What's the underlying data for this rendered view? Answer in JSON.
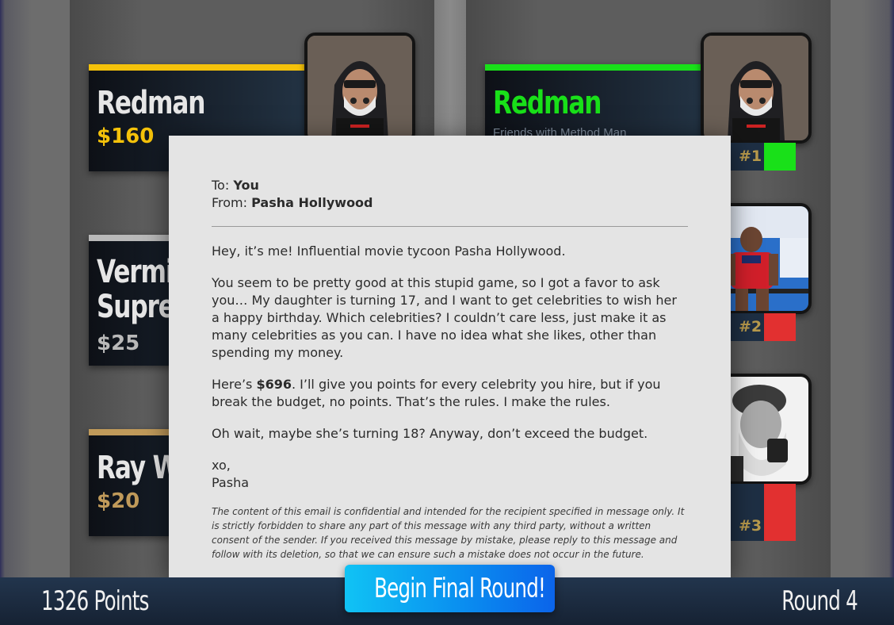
{
  "left_column": {
    "cards": [
      {
        "name_lines": [
          "Redman"
        ],
        "price": "$160",
        "bar_color": "#f5c20a",
        "price_color": "#f5c20a"
      },
      {
        "name_lines": [
          "Vermin",
          "Suprem"
        ],
        "price": "$25",
        "bar_color": "#b9b9b9",
        "price_color": "#b9b9b9"
      },
      {
        "name_lines": [
          "Ray Wil"
        ],
        "price": "$20",
        "bar_color": "#c09a5a",
        "price_color": "#c09a5a"
      }
    ]
  },
  "right_column": {
    "top_card": {
      "name": "Redman",
      "subtitle": "Friends with Method Man",
      "bar_color": "#19e019",
      "name_color": "#19e019"
    },
    "ranks": [
      {
        "label": "#1",
        "swatch_color": "#19e019"
      },
      {
        "label": "#2",
        "swatch_color": "#e23030"
      },
      {
        "label": "#3",
        "swatch_color": "#e23030"
      }
    ]
  },
  "email": {
    "to_label": "To:",
    "to_value": "You",
    "from_label": "From:",
    "from_value": "Pasha Hollywood",
    "p1": "Hey, it’s me! Influential movie tycoon Pasha Hollywood.",
    "p2": "You seem to be pretty good at this stupid game, so I got a favor to ask you… My daughter is turning 17, and I want to get celebrities to wish her a happy birthday. Which celebrities? I couldn’t care less, just make it as many celebrities as you can. I have no idea what she likes, other than spending my money.",
    "p3_before": "Here’s ",
    "p3_budget": "$696",
    "p3_after": ". I’ll give you points for every celebrity you hire, but if you break the budget, no points. That’s the rules. I make the rules.",
    "p4": "Oh wait, maybe she’s turning 18? Anyway, don’t exceed the budget.",
    "signoff": "xo,",
    "signature": "Pasha",
    "legal": "The content of this email is confidential and intended for the recipient specified in message only. It is strictly forbidden to share any part of this message with any third party, without a written consent of the sender. If you received this message by mistake, please reply to this message and follow with its deletion, so that we can ensure such a mistake does not occur in the future."
  },
  "footer": {
    "points": "1326 Points",
    "round": "Round 4",
    "begin_button": "Begin Final Round!"
  },
  "colors": {
    "accent_button": "#0a8ff0",
    "gold": "#f5c20a",
    "green": "#19e019",
    "red": "#e23030"
  }
}
